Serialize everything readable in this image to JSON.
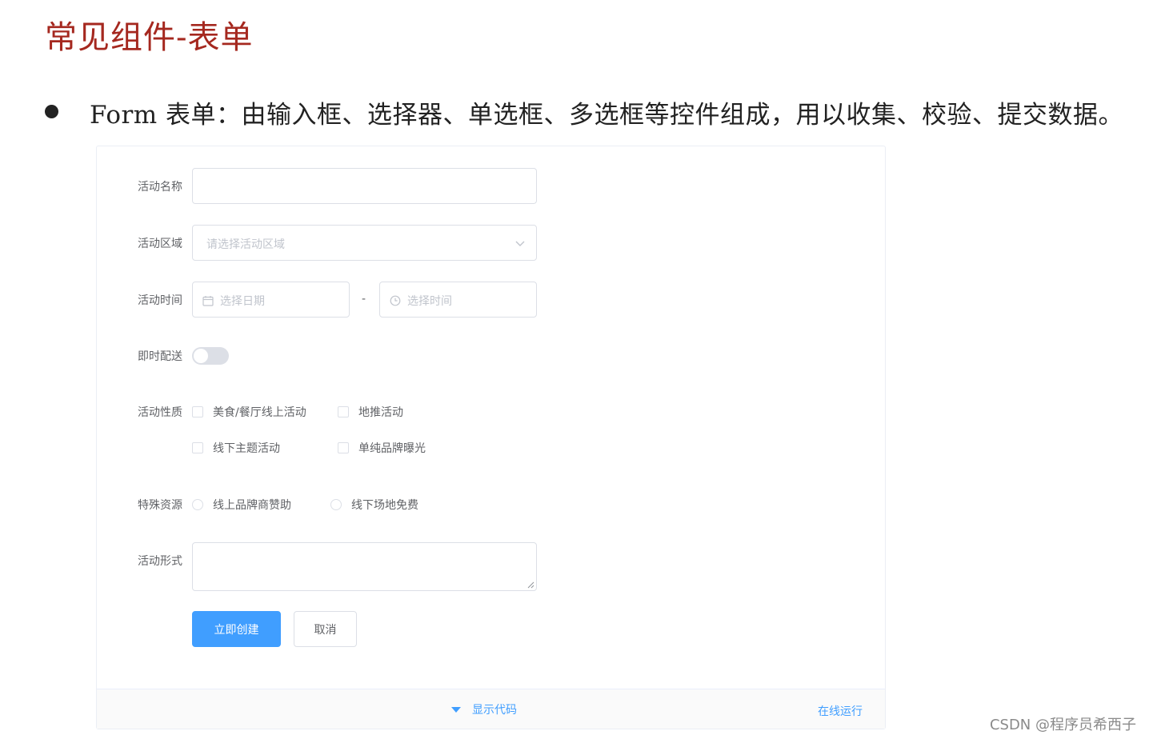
{
  "slide": {
    "title": "常见组件-表单",
    "bullet": "Form 表单：由输入框、选择器、单选框、多选框等控件组成，用以收集、校验、提交数据。"
  },
  "form": {
    "labels": {
      "name": "活动名称",
      "region": "活动区域",
      "time": "活动时间",
      "delivery": "即时配送",
      "type": "活动性质",
      "resource": "特殊资源",
      "desc": "活动形式"
    },
    "name_value": "",
    "region_placeholder": "请选择活动区域",
    "date_placeholder": "选择日期",
    "time_separator": "-",
    "time_placeholder": "选择时间",
    "delivery_on": false,
    "type_options": [
      "美食/餐厅线上活动",
      "地推活动",
      "线下主题活动",
      "单纯品牌曝光"
    ],
    "resource_options": [
      "线上品牌商赞助",
      "线下场地免费"
    ],
    "desc_value": "",
    "submit_label": "立即创建",
    "cancel_label": "取消"
  },
  "footer": {
    "show_code": "显示代码",
    "run_online": "在线运行"
  },
  "watermark": "CSDN @程序员希西子",
  "colors": {
    "title": "#a5281f",
    "primary": "#409eff",
    "border": "#dcdfe6",
    "placeholder": "#c0c4cc",
    "label": "#606266"
  },
  "icons": {
    "date": "calendar-icon",
    "time": "clock-icon",
    "select": "chevron-down-icon",
    "footer": "caret-down-icon"
  }
}
